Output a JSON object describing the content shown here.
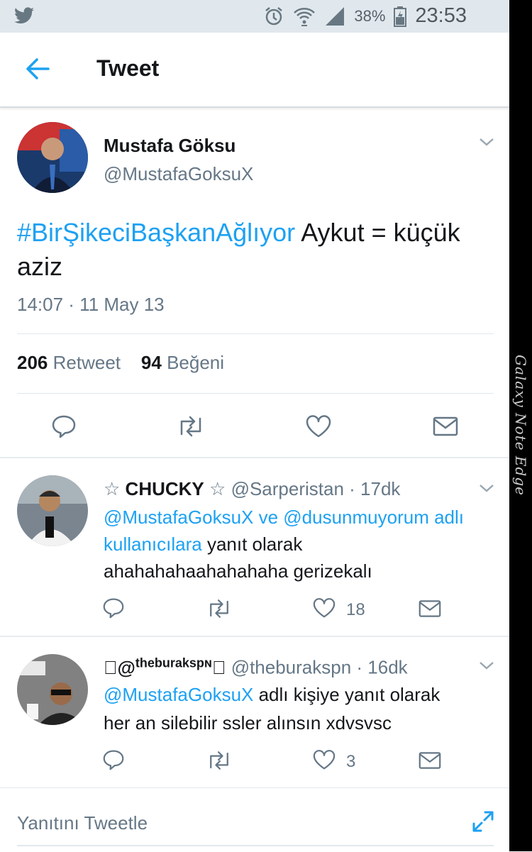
{
  "statusbar": {
    "battery": "38%",
    "time": "23:53"
  },
  "device_label": "Galaxy Note Edge",
  "header": {
    "title": "Tweet"
  },
  "tweet": {
    "author_name": "Mustafa Göksu",
    "author_handle": "@MustafaGoksuX",
    "hashtag": "#BirŞikeciBaşkanAğlıyor",
    "text_rest": " Aykut = küçük aziz",
    "timestamp": "14:07 · 11 May 13",
    "retweet_count": "206",
    "retweet_label": "Retweet",
    "like_count": "94",
    "like_label": "Beğeni"
  },
  "replies": [
    {
      "name": "CHUCKY",
      "handle": "@Sarperistan",
      "time": "· 17dk",
      "mentions": "@MustafaGoksuX ve @dusunmuyorum adlı kullanıcılara",
      "reply_suffix": " yanıt olarak",
      "text": "ahahahahaahahahaha gerizekalı",
      "like_count": "18",
      "star_left": "☆",
      "star_right": "☆"
    },
    {
      "name_prefix": "\u0000@",
      "name_small": "theburakspɴ",
      "name_suffix": "\u0000",
      "handle": "@theburakspn",
      "time": "· 16dk",
      "mentions": "@MustafaGoksuX",
      "reply_suffix": " adlı kişiye yanıt olarak",
      "text": "her an silebilir ssler alınsın xdvsvsc",
      "like_count": "3"
    }
  ],
  "compose": {
    "placeholder": "Yanıtını Tweetle"
  },
  "colors": {
    "accent": "#1da1f2",
    "text": "#14171a",
    "secondary": "#657786",
    "statusbar": "#e1e8ed"
  }
}
